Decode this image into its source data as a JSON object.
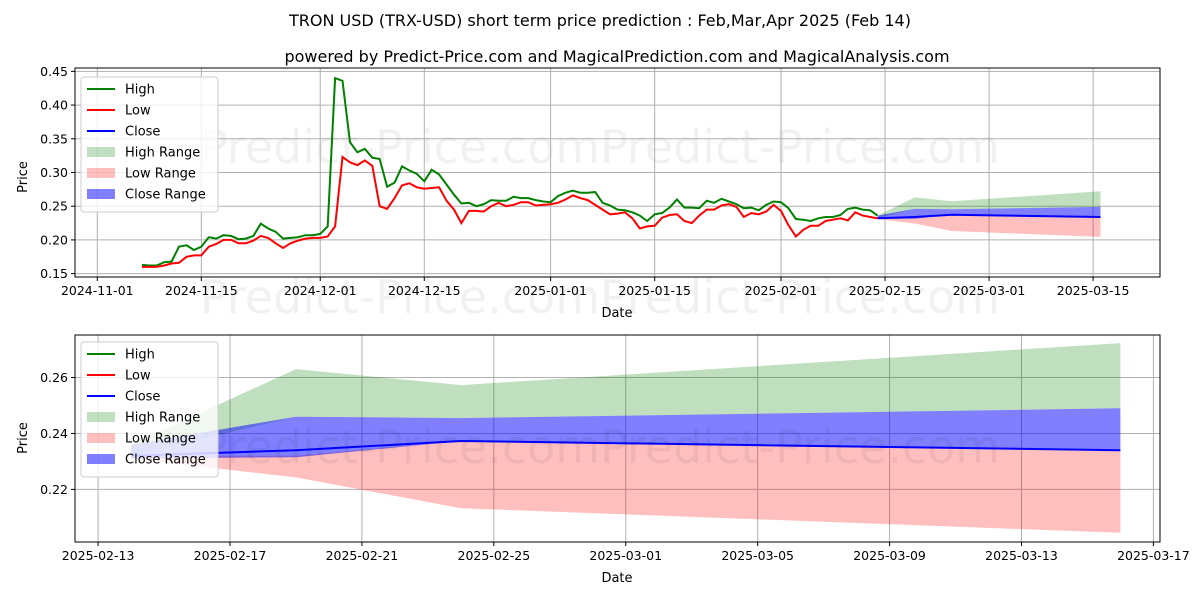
{
  "title": "TRON USD (TRX-USD) short term price prediction : Feb,Mar,Apr 2025 (Feb 14)",
  "subtitle": "powered by Predict-Price.com and MagicalPrediction.com and MagicalAnalysis.com",
  "watermark": "Predict-Price.com",
  "colors": {
    "high": "#008000",
    "low": "#ff0000",
    "close": "#0000ff",
    "high_range": "#008000",
    "low_range": "#ff0000",
    "close_range": "#0000ff"
  },
  "legend": {
    "placement": "top-left",
    "items": [
      {
        "label": "High",
        "kind": "line",
        "color": "#008000"
      },
      {
        "label": "Low",
        "kind": "line",
        "color": "#ff0000"
      },
      {
        "label": "Close",
        "kind": "line",
        "color": "#0000ff"
      },
      {
        "label": "High Range",
        "kind": "patch",
        "color": "#008000"
      },
      {
        "label": "Low Range",
        "kind": "patch",
        "color": "#ff0000"
      },
      {
        "label": "Close Range",
        "kind": "patch",
        "color": "#0000ff"
      }
    ]
  },
  "chart_data": [
    {
      "type": "line",
      "panel": "top",
      "xlabel": "Date",
      "ylabel": "Price",
      "grid": true,
      "xlim": [
        "2024-10-29",
        "2025-03-24"
      ],
      "ylim": [
        0.145,
        0.455
      ],
      "xticks": [
        "2024-11-01",
        "2024-11-15",
        "2024-12-01",
        "2024-12-15",
        "2025-01-01",
        "2025-01-15",
        "2025-02-01",
        "2025-02-15",
        "2025-03-01",
        "2025-03-15"
      ],
      "yticks": [
        "0.15",
        "0.20",
        "0.25",
        "0.30",
        "0.35",
        "0.40",
        "0.45"
      ],
      "history_start": "2024-11-07",
      "history": {
        "high": [
          0.163,
          0.162,
          0.162,
          0.167,
          0.168,
          0.19,
          0.192,
          0.185,
          0.19,
          0.204,
          0.202,
          0.207,
          0.206,
          0.201,
          0.202,
          0.206,
          0.224,
          0.217,
          0.212,
          0.202,
          0.203,
          0.204,
          0.207,
          0.207,
          0.209,
          0.22,
          0.44,
          0.436,
          0.345,
          0.33,
          0.335,
          0.322,
          0.32,
          0.279,
          0.285,
          0.309,
          0.303,
          0.298,
          0.287,
          0.304,
          0.297,
          0.282,
          0.267,
          0.254,
          0.255,
          0.25,
          0.253,
          0.259,
          0.258,
          0.258,
          0.264,
          0.262,
          0.262,
          0.259,
          0.257,
          0.256,
          0.265,
          0.27,
          0.273,
          0.27,
          0.27,
          0.271,
          0.255,
          0.251,
          0.245,
          0.244,
          0.241,
          0.236,
          0.228,
          0.238,
          0.24,
          0.248,
          0.26,
          0.248,
          0.248,
          0.247,
          0.258,
          0.255,
          0.261,
          0.257,
          0.253,
          0.247,
          0.248,
          0.244,
          0.252,
          0.257,
          0.256,
          0.247,
          0.231,
          0.23,
          0.228,
          0.232,
          0.234,
          0.234,
          0.237,
          0.246,
          0.248,
          0.245,
          0.244,
          0.236
        ],
        "low": [
          0.16,
          0.16,
          0.16,
          0.162,
          0.165,
          0.166,
          0.175,
          0.177,
          0.177,
          0.19,
          0.194,
          0.2,
          0.2,
          0.195,
          0.195,
          0.199,
          0.206,
          0.203,
          0.195,
          0.188,
          0.195,
          0.199,
          0.202,
          0.203,
          0.203,
          0.205,
          0.22,
          0.323,
          0.315,
          0.311,
          0.318,
          0.31,
          0.25,
          0.246,
          0.262,
          0.281,
          0.284,
          0.278,
          0.276,
          0.277,
          0.278,
          0.258,
          0.245,
          0.225,
          0.243,
          0.243,
          0.242,
          0.25,
          0.255,
          0.25,
          0.252,
          0.256,
          0.256,
          0.251,
          0.252,
          0.253,
          0.255,
          0.26,
          0.266,
          0.262,
          0.259,
          0.252,
          0.245,
          0.238,
          0.239,
          0.241,
          0.232,
          0.217,
          0.22,
          0.221,
          0.233,
          0.237,
          0.238,
          0.228,
          0.225,
          0.236,
          0.245,
          0.245,
          0.251,
          0.253,
          0.249,
          0.234,
          0.24,
          0.238,
          0.242,
          0.252,
          0.243,
          0.222,
          0.205,
          0.215,
          0.221,
          0.221,
          0.228,
          0.23,
          0.232,
          0.229,
          0.241,
          0.236,
          0.234,
          0.232
        ]
      },
      "forecast": {
        "dates": [
          "2025-02-14",
          "2025-02-19",
          "2025-02-24",
          "2025-03-16"
        ],
        "close": [
          0.232,
          0.234,
          0.2373,
          0.234
        ],
        "high_range": {
          "upper": [
            0.236,
            0.263,
            0.2573,
            0.2723
          ],
          "lower": [
            0.232,
            0.246,
            0.2455,
            0.249
          ]
        },
        "low_range": {
          "upper": [
            0.232,
            0.232,
            0.2373,
            0.234
          ],
          "lower": [
            0.231,
            0.2243,
            0.2133,
            0.2045
          ]
        },
        "close_range": {
          "upper": [
            0.236,
            0.246,
            0.2455,
            0.249
          ],
          "lower": [
            0.231,
            0.2315,
            0.2373,
            0.234
          ]
        }
      }
    },
    {
      "type": "area",
      "panel": "bottom",
      "xlabel": "Date",
      "ylabel": "Price",
      "grid": true,
      "xlim": [
        "2025-02-12.3",
        "2025-03-17.2"
      ],
      "ylim": [
        0.2012,
        0.2752
      ],
      "xticks": [
        "2025-02-13",
        "2025-02-17",
        "2025-02-21",
        "2025-02-25",
        "2025-03-01",
        "2025-03-05",
        "2025-03-09",
        "2025-03-13",
        "2025-03-17"
      ],
      "yticks": [
        "0.22",
        "0.24",
        "0.26"
      ],
      "series_ref": "top.forecast"
    }
  ]
}
